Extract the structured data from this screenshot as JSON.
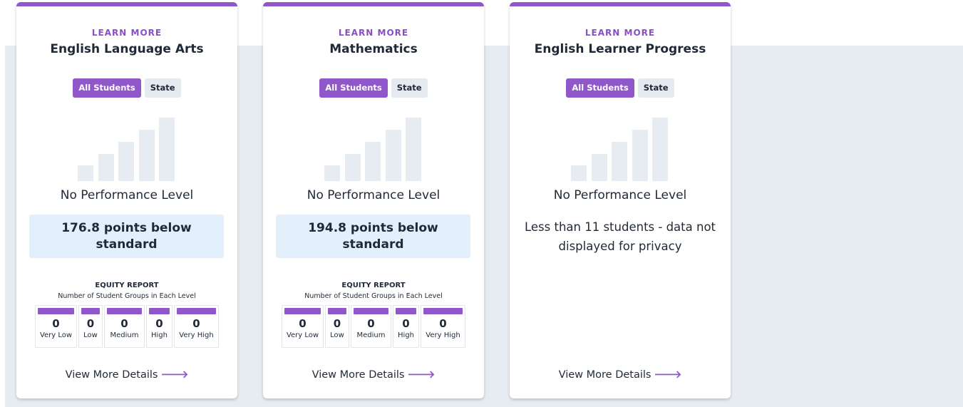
{
  "cards": [
    {
      "learn_more": "LEARN MORE",
      "title": "English Language Arts",
      "toggle_all": "All Students",
      "toggle_state": "State",
      "performance": "No Performance Level",
      "points": "176.8 points below standard",
      "equity_title": "EQUITY REPORT",
      "equity_subtitle": "Number of Student Groups in Each Level",
      "levels": [
        {
          "count": "0",
          "label": "Very Low"
        },
        {
          "count": "0",
          "label": "Low"
        },
        {
          "count": "0",
          "label": "Medium"
        },
        {
          "count": "0",
          "label": "High"
        },
        {
          "count": "0",
          "label": "Very High"
        }
      ],
      "details": "View More Details"
    },
    {
      "learn_more": "LEARN MORE",
      "title": "Mathematics",
      "toggle_all": "All Students",
      "toggle_state": "State",
      "performance": "No Performance Level",
      "points": "194.8 points below standard",
      "equity_title": "EQUITY REPORT",
      "equity_subtitle": "Number of Student Groups in Each Level",
      "levels": [
        {
          "count": "0",
          "label": "Very Low"
        },
        {
          "count": "0",
          "label": "Low"
        },
        {
          "count": "0",
          "label": "Medium"
        },
        {
          "count": "0",
          "label": "High"
        },
        {
          "count": "0",
          "label": "Very High"
        }
      ],
      "details": "View More Details"
    },
    {
      "learn_more": "LEARN MORE",
      "title": "English Learner Progress",
      "toggle_all": "All Students",
      "toggle_state": "State",
      "performance": "No Performance Level",
      "privacy": "Less than 11 students - data not displayed for privacy",
      "details": "View More Details"
    }
  ],
  "icons": {
    "arrow": "arrow-right-icon",
    "bars": "performance-bars-icon"
  },
  "colors": {
    "accent": "#8f57c9",
    "band": "#e7ebf2",
    "points_bg": "#e3effb"
  }
}
